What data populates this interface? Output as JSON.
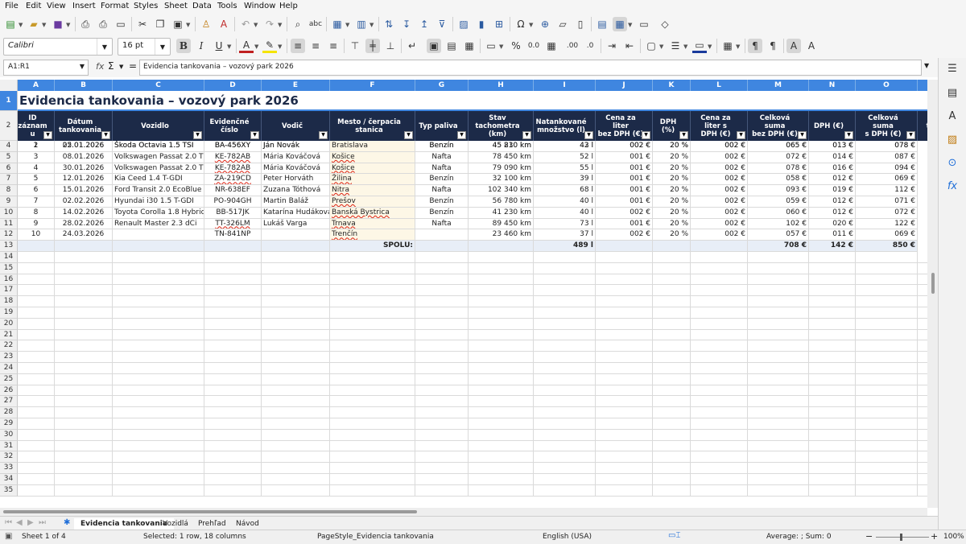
{
  "menu": [
    "File",
    "Edit",
    "View",
    "Insert",
    "Format",
    "Styles",
    "Sheet",
    "Data",
    "Tools",
    "Window",
    "Help"
  ],
  "toolbar": {
    "font_name": "Calibri",
    "font_size": "16 pt"
  },
  "formula": {
    "cell_ref": "A1:R1",
    "content": "Evidencia tankovania – vozový park 2026"
  },
  "columns": [
    "A",
    "B",
    "C",
    "D",
    "E",
    "F",
    "G",
    "H",
    "I",
    "J",
    "K",
    "L",
    "M",
    "N",
    "O"
  ],
  "title": "Evidencia tankovania – vozový park 2026",
  "headers": {
    "A": [
      "ID",
      "záznam",
      "u"
    ],
    "B": [
      "Dátum",
      "tankovania"
    ],
    "C": [
      "Vozidlo"
    ],
    "D": [
      "Evidenčné",
      "číslo"
    ],
    "E": [
      "Vodič"
    ],
    "F": [
      "Mesto / čerpacia",
      "stanica"
    ],
    "G": [
      "Typ paliva"
    ],
    "H": [
      "Stav",
      "tachometra",
      "(km)"
    ],
    "I": [
      "Natankované",
      "množstvo (l)"
    ],
    "J": [
      "Cena za liter",
      "bez DPH (€)"
    ],
    "K": [
      "DPH",
      "(%)"
    ],
    "L": [
      "Cena za liter s",
      "DPH (€)"
    ],
    "M": [
      "Celková suma",
      "bez DPH (€)"
    ],
    "N": [
      "DPH (€)"
    ],
    "O": [
      "Celková suma",
      "s DPH (€)"
    ],
    "P": [
      "ta"
    ]
  },
  "rows": [
    [
      "1",
      "05.01.2026",
      "Škoda Octavia 1.5 TSI",
      "BA-456XY",
      "Ján Novák",
      "Bratislava",
      "Benzín",
      "45 230 km",
      "43 l",
      "002 €",
      "20 %",
      "002 €",
      "065 €",
      "013 €",
      "078 €"
    ],
    [
      "2",
      "22.01.2026",
      "Škoda Octavia 1.5 TSI",
      "BA-456XY",
      "Ján Novák",
      "Bratislava",
      "Benzín",
      "45 810 km",
      "42 l",
      "002 €",
      "20 %",
      "002 €",
      "065 €",
      "013 €",
      "078 €"
    ],
    [
      "3",
      "08.01.2026",
      "Volkswagen Passat 2.0 TDI",
      "KE-782AB",
      "Mária Kováčová",
      "Košice",
      "Nafta",
      "78 450 km",
      "52 l",
      "001 €",
      "20 %",
      "002 €",
      "072 €",
      "014 €",
      "087 €"
    ],
    [
      "4",
      "30.01.2026",
      "Volkswagen Passat 2.0 TDI",
      "KE-782AB",
      "Mária Kováčová",
      "Košice",
      "Nafta",
      "79 090 km",
      "55 l",
      "001 €",
      "20 %",
      "002 €",
      "078 €",
      "016 €",
      "094 €"
    ],
    [
      "5",
      "12.01.2026",
      "Kia Ceed 1.4 T-GDI",
      "ZA-219CD",
      "Peter Horváth",
      "Žilina",
      "Benzín",
      "32 100 km",
      "39 l",
      "001 €",
      "20 %",
      "002 €",
      "058 €",
      "012 €",
      "069 €"
    ],
    [
      "6",
      "15.01.2026",
      "Ford Transit 2.0 EcoBlue",
      "NR-638EF",
      "Zuzana Tóthová",
      "Nitra",
      "Nafta",
      "102 340 km",
      "68 l",
      "001 €",
      "20 %",
      "002 €",
      "093 €",
      "019 €",
      "112 €"
    ],
    [
      "7",
      "02.02.2026",
      "Hyundai i30 1.5 T-GDI",
      "PO-904GH",
      "Martin Baláž",
      "Prešov",
      "Benzín",
      "56 780 km",
      "40 l",
      "001 €",
      "20 %",
      "002 €",
      "059 €",
      "012 €",
      "071 €"
    ],
    [
      "8",
      "14.02.2026",
      "Toyota Corolla 1.8 Hybrid",
      "BB-517JK",
      "Katarína Hudáková",
      "Banská Bystrica",
      "Benzín",
      "41 230 km",
      "40 l",
      "002 €",
      "20 %",
      "002 €",
      "060 €",
      "012 €",
      "072 €"
    ],
    [
      "9",
      "28.02.2026",
      "Renault Master 2.3 dCi",
      "TT-326LM",
      "Lukáš Varga",
      "Trnava",
      "Nafta",
      "89 450 km",
      "73 l",
      "001 €",
      "20 %",
      "002 €",
      "102 €",
      "020 €",
      "122 €"
    ],
    [
      "10",
      "24.03.2026",
      "",
      "TN-841NP",
      "",
      "Trenčín",
      "",
      "23 460 km",
      "37 l",
      "002 €",
      "20 %",
      "002 €",
      "057 €",
      "011 €",
      "069 €"
    ]
  ],
  "sum_row": {
    "label": "SPOLU:",
    "I": "489 l",
    "M": "708 €",
    "N": "142 €",
    "O": "850 €"
  },
  "row_numbers": [
    "1",
    "2",
    "3",
    "4",
    "5",
    "6",
    "7",
    "8",
    "9",
    "10",
    "11",
    "12",
    "13",
    "14",
    "15",
    "16",
    "17",
    "18",
    "19",
    "20",
    "21",
    "22",
    "23",
    "24",
    "25",
    "26",
    "27",
    "28",
    "29",
    "30",
    "31",
    "32",
    "33",
    "34",
    "35"
  ],
  "tabs": [
    "Evidencia tankovania",
    "Vozidlá",
    "Prehľad",
    "Návod"
  ],
  "status": {
    "sheet": "Sheet 1 of 4",
    "selection": "Selected: 1 row, 18 columns",
    "page_style": "PageStyle_Evidencia tankovania",
    "language": "English (USA)",
    "summary": "Average: ; Sum: 0",
    "zoom": "100%"
  }
}
